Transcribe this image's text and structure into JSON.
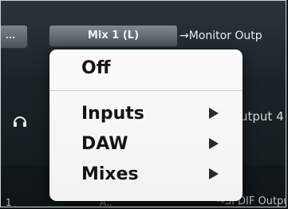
{
  "toolbar": {
    "prev_button_label": "...",
    "mix_button_label": "Mix 1 (L)",
    "destination_label": "→Monitor Outp"
  },
  "rows": {
    "row2_output_text": "utput 4",
    "row3_left_text": "1",
    "row3_mid_text": "A..",
    "row3_output_text": "→SPDIF Outpu"
  },
  "menu": {
    "off_label": "Off",
    "items": [
      {
        "label": "Inputs",
        "has_submenu": true
      },
      {
        "label": "DAW",
        "has_submenu": true
      },
      {
        "label": "Mixes",
        "has_submenu": true
      }
    ]
  },
  "icons": {
    "headphone": "headphones-icon",
    "submenu_arrow": "submenu-arrow-icon"
  }
}
